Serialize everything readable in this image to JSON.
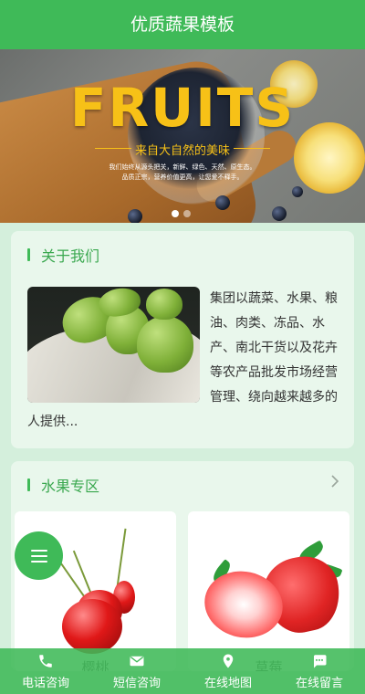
{
  "header": {
    "title": "优质蔬果模板"
  },
  "banner": {
    "title": "FRUITS",
    "subtitle": "来自大自然的美味",
    "desc_line1": "我们始终从源头把关，新鲜、绿色、天然、原生态。",
    "desc_line2": "品质正宗，营养价值更高，让您爱不释手。",
    "dots": 2,
    "active_dot": 0
  },
  "about": {
    "title": "关于我们",
    "text": "集团以蔬菜、水果、粮油、肉类、冻品、水产、南北干货以及花卉等农产品批发市场经营管理、绕向越来越多的人提供..."
  },
  "fruit_zone": {
    "title": "水果专区",
    "more_icon": "chevron-right-icon",
    "items": [
      {
        "name": "樱桃",
        "image": "cherry"
      },
      {
        "name": "草莓",
        "image": "strawberry"
      }
    ]
  },
  "fab": {
    "icon": "menu-icon"
  },
  "bottom_nav": [
    {
      "label": "电话咨询",
      "icon": "phone-icon"
    },
    {
      "label": "短信咨询",
      "icon": "mail-icon"
    },
    {
      "label": "在线地图",
      "icon": "map-pin-icon"
    },
    {
      "label": "在线留言",
      "icon": "chat-icon"
    }
  ],
  "colors": {
    "primary": "#3fba58",
    "banner_title": "#f7c117",
    "background": "#d4efdc"
  }
}
